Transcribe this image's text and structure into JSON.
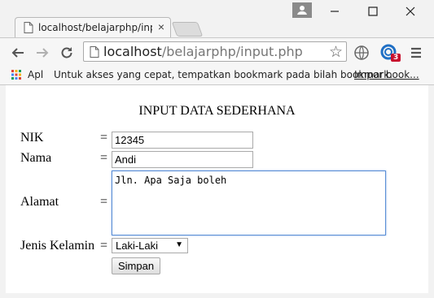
{
  "browser": {
    "tab_title": "localhost/belajarphp/input",
    "tab_close": "×",
    "url_host": "localhost",
    "url_path": "/belajarphp/input.php",
    "extension_badge": "3",
    "bookmarks": {
      "apps_label": "Apl",
      "hint": "Untuk akses yang cepat, tempatkan bookmark pada bilah bookmark.",
      "import_label": "Impor book..."
    }
  },
  "form": {
    "title": "INPUT DATA SEDERHANA",
    "separator": "=",
    "nik_label": "NIK",
    "nik_value": "12345",
    "nama_label": "Nama",
    "nama_value": "Andi",
    "alamat_label": "Alamat",
    "alamat_value": "Jln. Apa Saja boleh",
    "jenis_kelamin_label": "Jenis Kelamin",
    "jenis_kelamin_value": "Laki-Laki",
    "submit_label": "Simpan"
  }
}
